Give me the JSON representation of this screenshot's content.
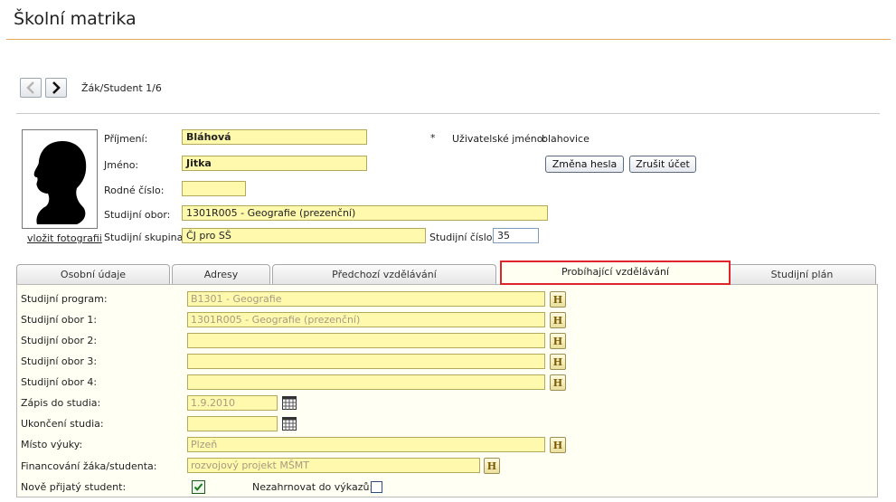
{
  "page": {
    "title": "Školní matrika"
  },
  "nav": {
    "label": "Žák/Student 1/6"
  },
  "student": {
    "photo_link": "vložit fotografii",
    "surname_label": "Příjmení:",
    "surname": "Bláhová",
    "required_mark": "*",
    "username_label": "Uživatelské jméno:",
    "username": "blahovice",
    "name_label": "Jméno:",
    "name": "Jitka",
    "change_password": "Změna hesla",
    "cancel_account": "Zrušit účet",
    "birth_label": "Rodné číslo:",
    "birth": "",
    "field_label": "Studijní obor:",
    "field": "1301R005 - Geografie (prezenční)",
    "group_label": "Studijní skupina:",
    "group": "ČJ pro SŠ",
    "number_label": "Studijní číslo:",
    "number": "35"
  },
  "tabs": [
    {
      "label": "Osobní údaje"
    },
    {
      "label": "Adresy"
    },
    {
      "label": "Předchozí vzdělávání"
    },
    {
      "label": "Probíhající vzdělávání"
    },
    {
      "label": "Studijní plán"
    }
  ],
  "panel": {
    "program_label": "Studijní program:",
    "program": "B1301 - Geografie",
    "obor1_label": "Studijní obor 1:",
    "obor1": "1301R005 - Geografie (prezenční)",
    "obor2_label": "Studijní obor 2:",
    "obor2": "",
    "obor3_label": "Studijní obor 3:",
    "obor3": "",
    "obor4_label": "Studijní obor 4:",
    "obor4": "",
    "enroll_label": "Zápis do studia:",
    "enroll": "1.9.2010",
    "end_label": "Ukončení studia:",
    "end": "",
    "place_label": "Místo výuky:",
    "place": "Plzeň",
    "funding_label": "Financování žáka/studenta:",
    "funding": "rozvojový projekt MŠMT",
    "new_label": "Nově přijatý student:",
    "new_checked": true,
    "exclude_label": "Nezahrnovat do výkazů:",
    "exclude_checked": false,
    "h_label": "H"
  }
}
